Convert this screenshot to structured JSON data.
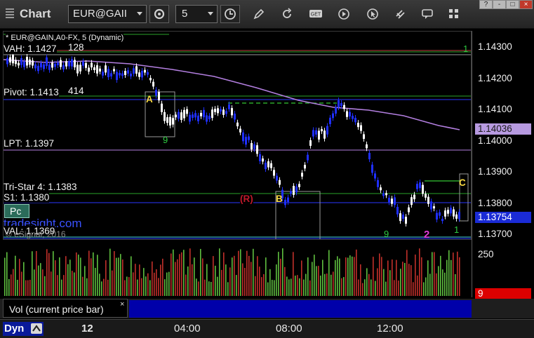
{
  "app": {
    "title": "Chart"
  },
  "toolbar": {
    "symbol": "EUR@GAII",
    "interval": "5",
    "icons": [
      "settings-gear-icon",
      "clock-icon",
      "pencil-icon",
      "refresh-icon",
      "get-icon",
      "play-icon",
      "cursor-icon",
      "chat-icon",
      "grid-icon"
    ]
  },
  "window_controls": {
    "help": "?",
    "minimize": "-",
    "maximize": "□",
    "close": "×"
  },
  "chart": {
    "header": "* EUR@GAIN,A0-FX, 5 (Dynamic)",
    "levels": {
      "vah": "VAH: 1.1427",
      "vah_tail": "128",
      "pivot": "Pivot: 1.1413",
      "pivot_tail": "414",
      "lpt": "LPT: 1.1397",
      "tristar": "Tri-Star 4: 1.1383",
      "s1": "S1: 1.1380",
      "val": "VAL: 1.1369"
    },
    "watermark": "tradesight.com",
    "copyright": "© eSignal, 2016",
    "pc_label": "Pc",
    "annotations": {
      "a": "A",
      "b": "B",
      "c": "C",
      "r": "(R)",
      "two": "2",
      "nine": "9",
      "one": "1"
    },
    "price_ticks": [
      "1.14300",
      "1.14200",
      "1.14100",
      "1.14000",
      "1.13900",
      "1.13800",
      "1.13700"
    ],
    "current_price": "1.13754",
    "ma_price": "1.14036",
    "vol_axis_label": "250",
    "vol_value": "9"
  },
  "volume_panel": {
    "tab_label": "Vol (current price bar)",
    "tab_close": "×"
  },
  "time_axis": {
    "mode": "Dyn",
    "labels": [
      "12",
      "04:00",
      "08:00",
      "12:00"
    ]
  },
  "colors": {
    "up": "#ffffff",
    "down": "#1f2fff",
    "ma": "#b37fe0",
    "level": "#2aa52a",
    "vol_up": "#5fbf3f",
    "vol_down": "#c0302a",
    "accent": "#ff1a1a"
  }
}
